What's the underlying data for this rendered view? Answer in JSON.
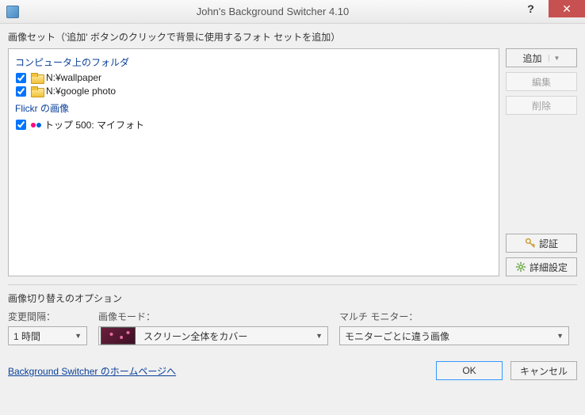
{
  "window": {
    "title": "John's Background Switcher 4.10",
    "help_symbol": "?",
    "close_symbol": "✕"
  },
  "main": {
    "sets_label": "画像セット（'追加' ボタンのクリックで背景に使用するフォト セットを追加）",
    "groups": [
      {
        "header": "コンピュータ上のフォルダ",
        "type": "folder",
        "items": [
          {
            "checked": true,
            "label": "N:¥wallpaper"
          },
          {
            "checked": true,
            "label": "N:¥google photo"
          }
        ]
      },
      {
        "header": "Flickr の画像",
        "type": "flickr",
        "items": [
          {
            "checked": true,
            "label": "トップ 500: マイフォト"
          }
        ]
      }
    ],
    "buttons": {
      "add": "追加",
      "edit": "編集",
      "delete": "削除",
      "auth": "認証",
      "advanced": "詳細設定"
    }
  },
  "options": {
    "section_label": "画像切り替えのオプション",
    "interval_label": "変更間隔：",
    "interval_value": "1 時間",
    "mode_label": "画像モード：",
    "mode_value": "スクリーン全体をカバー",
    "monitor_label": "マルチ モニター：",
    "monitor_value": "モニターごとに違う画像"
  },
  "footer": {
    "link": "Background Switcher のホームページへ",
    "ok": "OK",
    "cancel": "キャンセル"
  }
}
